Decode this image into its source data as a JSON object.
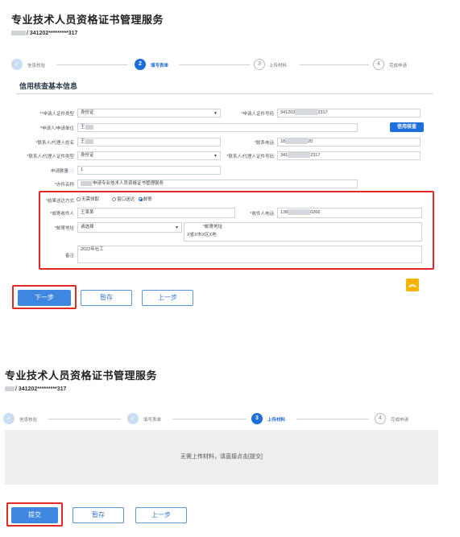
{
  "panel1": {
    "title": "专业技术人员资格证书管理服务",
    "subtitle_suffix": "/ 341202*********317",
    "steps": [
      {
        "num": "1",
        "label": "信息核验",
        "state": "done"
      },
      {
        "num": "2",
        "label": "填写表单",
        "state": "active"
      },
      {
        "num": "3",
        "label": "上传材料",
        "state": "todo"
      },
      {
        "num": "4",
        "label": "完成申请",
        "state": "todo"
      }
    ],
    "section_title": "信用核查基本信息",
    "form": {
      "applicant_id_type_label": "*申请人证件类型",
      "applicant_id_type_value": "身份证",
      "applicant_id_no_label": "*申请人证件号码",
      "applicant_id_no_prefix": "341202",
      "applicant_id_no_suffix": "2317",
      "applicant_unit_label": "*申请人/申请单位",
      "applicant_unit_value": "王",
      "credit_check_button": "信用核查",
      "contact_name_label": "*联系人/代理人姓名",
      "contact_name_value": "王",
      "contact_phone_label": "*联系电话",
      "contact_phone_prefix": "18",
      "contact_phone_suffix": "20",
      "contact_id_type_label": "*联系人/代理人证件类型",
      "contact_id_type_value": "身份证",
      "contact_id_no_label": "*联系人/代理人证件号码",
      "contact_id_no_prefix": "341",
      "contact_id_no_suffix": "2317",
      "quantity_label": "申请数量",
      "quantity_value": "1",
      "service_name_label": "*办件名称",
      "service_name_value": "申请专业技术人员资格证书管理服务",
      "delivery_label": "*结果送达方式",
      "delivery_options": [
        "无需领取",
        "窗口送达",
        "邮寄"
      ],
      "delivery_selected": 2,
      "recipient_label": "*邮寄收件人",
      "recipient_value": "王某某",
      "recipient_phone_label": "*收件人电话",
      "recipient_phone_prefix": "138",
      "recipient_phone_suffix": "0266",
      "mail_address_label": "*邮寄地址",
      "mail_address_select": "请选择",
      "mail_address_detail_label": "*邮寄地址",
      "mail_address_detail_value": "X省X市X区X地",
      "remark_label": "备注",
      "remark_value": "2022年社工"
    },
    "buttons": {
      "next": "下一步",
      "save": "暂存",
      "prev": "上一步"
    },
    "back_to_top_icon": "︽"
  },
  "panel2": {
    "title": "专业技术人员资格证书管理服务",
    "subtitle_suffix": "/ 341202*********317",
    "steps": [
      {
        "num": "1",
        "label": "信息核验",
        "state": "done"
      },
      {
        "num": "2",
        "label": "填写表单",
        "state": "done"
      },
      {
        "num": "3",
        "label": "上传材料",
        "state": "active"
      },
      {
        "num": "4",
        "label": "完成申请",
        "state": "todo"
      }
    ],
    "upload_message": "无需上传材料，请直接点击[提交]",
    "buttons": {
      "submit": "提交",
      "save": "暂存",
      "prev": "上一步"
    }
  },
  "colors": {
    "accent": "#1d6ed8",
    "highlight_red": "#e12a26",
    "back_to_top": "#f4b400"
  }
}
